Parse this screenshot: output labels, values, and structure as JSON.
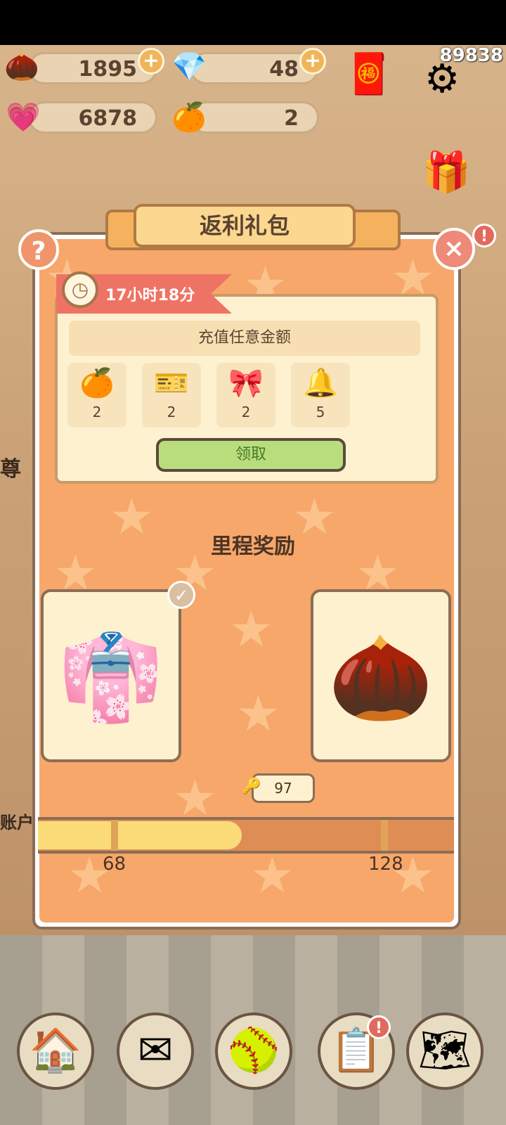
{
  "score": "89838",
  "resources": {
    "acorn": "1895",
    "gem": "48",
    "heart": "6878",
    "orange": "2"
  },
  "side": {
    "left_text_1": "尊",
    "left_text_2": "账户"
  },
  "popup": {
    "title": "返利礼包",
    "timer": "17小时18分",
    "condition": "充值任意金额",
    "items": [
      {
        "icon": "orange",
        "count": "2"
      },
      {
        "icon": "ticket",
        "count": "2"
      },
      {
        "icon": "gift-bundle",
        "count": "2"
      },
      {
        "icon": "bell",
        "count": "5"
      }
    ],
    "claim_label": "领取",
    "milestone_title": "里程奖励",
    "current_progress": "97",
    "milestones": [
      "68",
      "128"
    ],
    "progress_fraction": 0.49
  }
}
